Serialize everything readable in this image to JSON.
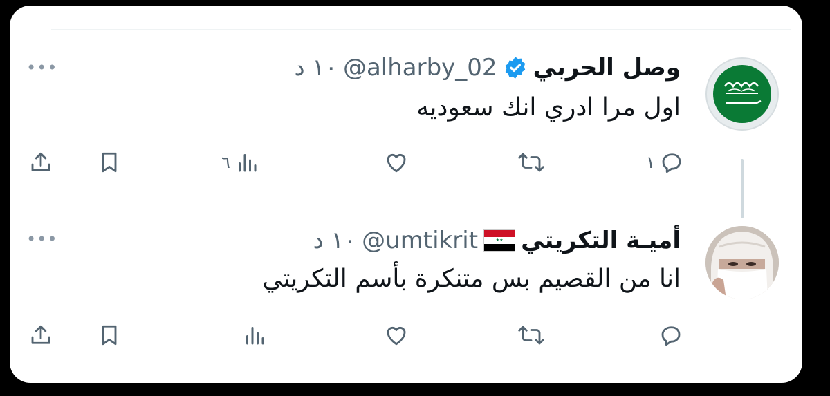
{
  "tweets": [
    {
      "display_name": "وصل الحربي",
      "handle": "@alharby_02",
      "time": "١٠ د",
      "text": "اول مرا ادري انك سعوديه",
      "badge": "verified-badge-icon",
      "avatar": "saudi-flag-avatar",
      "replies": "١",
      "views": "٦"
    },
    {
      "display_name": "أميـة التكريتي",
      "handle": "@umtikrit",
      "time": "١٠ د",
      "text": "انا من القصيم بس متنكرة بأسم التكريتي",
      "badge": "iraq-flag-emoji",
      "avatar": "veiled-woman-avatar",
      "replies": "",
      "views": ""
    }
  ],
  "colors": {
    "verified": "#1d9bf0",
    "text": "#0f1419",
    "secondary": "#536471",
    "saudi_green": "#0a7a35"
  }
}
